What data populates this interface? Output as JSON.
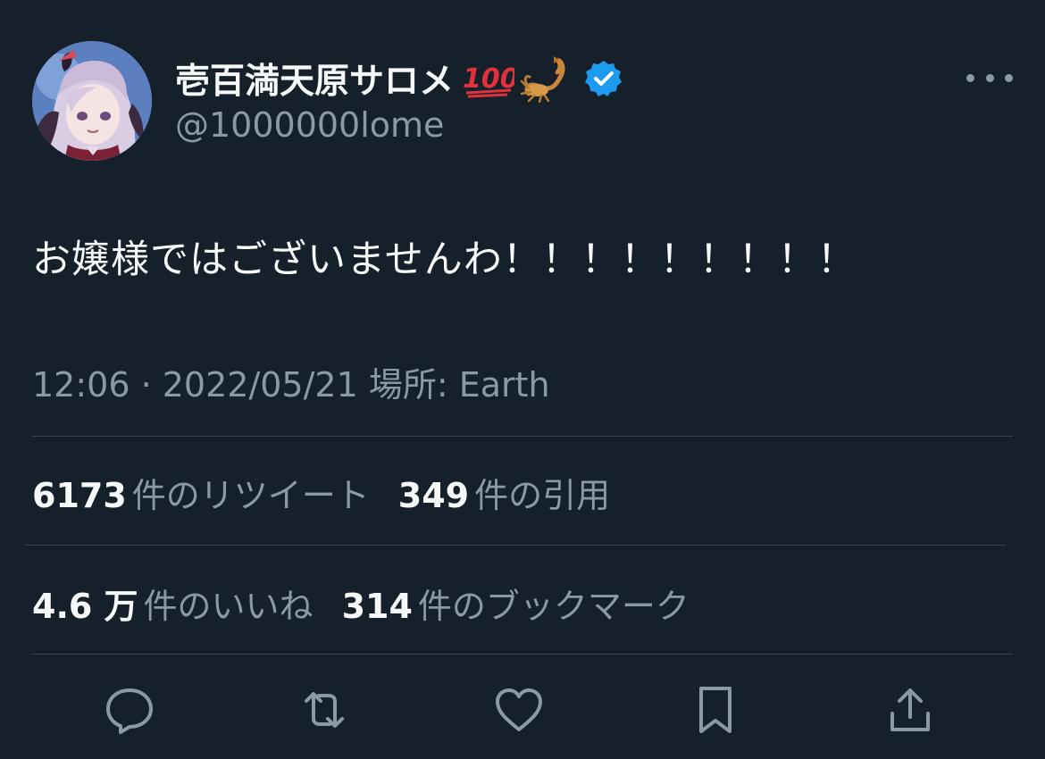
{
  "user": {
    "display_name": "壱百満天原サロメ",
    "handle": "@1000000lome",
    "badge_emojis": [
      "hundred-points-icon",
      "scorpion-icon"
    ],
    "verified": true
  },
  "tweet": {
    "text": "お嬢様ではございませんわ！！！！！！！！！",
    "meta": "12:06 · 2022/05/21 場所: Earth"
  },
  "stats": {
    "retweets": {
      "count": "6173",
      "label": "件のリツイート"
    },
    "quotes": {
      "count": "349",
      "label": "件の引用"
    },
    "likes": {
      "count": "4.6 万",
      "label": "件のいいね"
    },
    "bookmarks": {
      "count": "314",
      "label": "件のブックマーク"
    }
  },
  "colors": {
    "background": "#15202b",
    "text": "#f7f9f9",
    "secondary": "#8b98a5",
    "divider": "#38444d",
    "verified": "#1d9bf0"
  },
  "actions": [
    "reply-icon",
    "retweet-icon",
    "like-icon",
    "bookmark-icon",
    "share-icon"
  ]
}
